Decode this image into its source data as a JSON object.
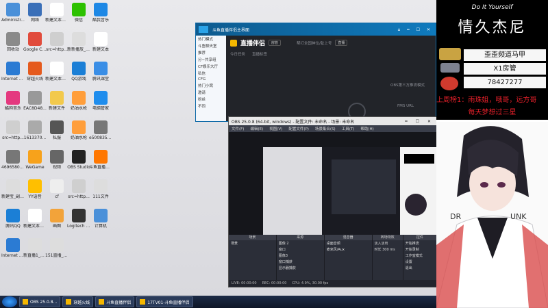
{
  "desktop": {
    "icons": [
      {
        "label": "Administr...",
        "color": "#4a90d9"
      },
      {
        "label": "网络",
        "color": "#3a6fb8"
      },
      {
        "label": "新建文本文档 (2)",
        "color": "#ffffff"
      },
      {
        "label": "微信",
        "color": "#2dc100"
      },
      {
        "label": "酷我音乐",
        "color": "#1e88e5"
      },
      {
        "label": "回收站",
        "color": "#8a8a8a"
      },
      {
        "label": "Google Chrome",
        "color": "#e14b3c"
      },
      {
        "label": "src=http...",
        "color": "#cfcfcf"
      },
      {
        "label": "新新播放_副本_副本_副本",
        "color": "#dddddd"
      },
      {
        "label": "新建文本",
        "color": "#ffffff"
      },
      {
        "label": "Internet Explorer",
        "color": "#2b7bd3"
      },
      {
        "label": "穿越火线",
        "color": "#e55a1d"
      },
      {
        "label": "新建文本文档 (3)",
        "color": "#ffffff"
      },
      {
        "label": "QQ游戏",
        "color": "#1b7fd6"
      },
      {
        "label": "腾讯课堂",
        "color": "#3a8ee6"
      },
      {
        "label": "酷狗音乐",
        "color": "#e4397f"
      },
      {
        "label": "EAC8D48...",
        "color": "#999999"
      },
      {
        "label": "新建文件",
        "color": "#f2c94c"
      },
      {
        "label": "奶油水枪",
        "color": "#ff9e3b"
      },
      {
        "label": "电脑管家",
        "color": "#1f8ded"
      },
      {
        "label": "src=http...",
        "color": "#cfcfcf"
      },
      {
        "label": "1613370...",
        "color": "#aaaaaa"
      },
      {
        "label": "私服",
        "color": "#555555"
      },
      {
        "label": "奶油水枪",
        "color": "#ff9e3b"
      },
      {
        "label": "e5008355...",
        "color": "#777777"
      },
      {
        "label": "46965806...",
        "color": "#777777"
      },
      {
        "label": "WeGame",
        "color": "#f7a21b"
      },
      {
        "label": "视频",
        "color": "#666666"
      },
      {
        "label": "OBS Studio",
        "color": "#222222"
      },
      {
        "label": "斗鱼直播伴侣",
        "color": "#ff7700"
      },
      {
        "label": "新建宝_副本 3331_副本",
        "color": "#dddddd"
      },
      {
        "label": "YY语音",
        "color": "#ffbf00"
      },
      {
        "label": "cf",
        "color": "#eeeeee"
      },
      {
        "label": "src=http...",
        "color": "#cfcfcf"
      },
      {
        "label": "111文件",
        "color": "#dddddd"
      },
      {
        "label": "腾讯QQ",
        "color": "#1b7fd6"
      },
      {
        "label": "新建文本文档",
        "color": "#ffffff"
      },
      {
        "label": "画图",
        "color": "#f2a33a"
      },
      {
        "label": "Logitech G HUB",
        "color": "#333333"
      },
      {
        "label": "计算机",
        "color": "#4a90d9"
      },
      {
        "label": "Internet Explorer",
        "color": "#2b7bd3"
      },
      {
        "label": "新直播1_副本",
        "color": "#dddddd"
      },
      {
        "label": "151直播_副本2222...",
        "color": "#dddddd"
      }
    ]
  },
  "live_window": {
    "title": "斗鱼直播伴侣主界面",
    "logo": "直播伴侣",
    "room_label": "房管",
    "tip": "帮打全国神位/耻上号",
    "status_tag": "直播",
    "hint_left": "今日任务",
    "hint_mid": "直播标签",
    "fans_label": "OBS第三方推流模式",
    "fms": "FMS URL",
    "side_items": [
      "热门模式",
      "斗鱼聊天室",
      "推荐",
      "分~共享组",
      "CF娱乐大厅",
      "私信",
      "CFG",
      "热门小窝",
      "邀请",
      "粉丝",
      "不同"
    ]
  },
  "obs": {
    "title": "OBS 25.0.8 (64-bit, windows) - 配置文件: 未命名 - 场景: 未命名",
    "menu": [
      "文件(F)",
      "编辑(E)",
      "视图(V)",
      "配置文件(P)",
      "场景集合(S)",
      "工具(T)",
      "帮助(H)"
    ],
    "docks": [
      {
        "head": "场景",
        "items": [
          "场景"
        ]
      },
      {
        "head": "来源",
        "items": [
          "图像 2",
          "窗口",
          "图像3",
          "窗口捕获",
          "显示器捕获"
        ]
      },
      {
        "head": "混音器",
        "items": [
          "桌面音频",
          "麦克风/Aux"
        ]
      },
      {
        "head": "转场特效",
        "items": [
          "淡入淡出",
          "时长 300 ms"
        ]
      },
      {
        "head": "控件",
        "items": [
          "开始推流",
          "开始录制",
          "工作室模式",
          "设置",
          "退出"
        ]
      }
    ],
    "status": [
      "LIVE: 00:00:00",
      "REC: 00:00:00",
      "CPU: 4.9%, 30.00 fps"
    ]
  },
  "taskbar": {
    "items": [
      "OBS 25.0.8...",
      "穿越火线",
      "斗鱼直播伴侣",
      "17TV01-斗鱼直播伴侣"
    ]
  },
  "overlay": {
    "small": "Do It Yourself",
    "big": "情久杰尼",
    "gifts": [
      "歪歪频道马甲",
      "X1房管",
      "78427277"
    ],
    "marquee": "上周榜1：雨珠姐，哦哥，远方哥",
    "dream": "每天梦想过三星",
    "char_letters_left": "DR",
    "char_letters_right": "UNK"
  }
}
